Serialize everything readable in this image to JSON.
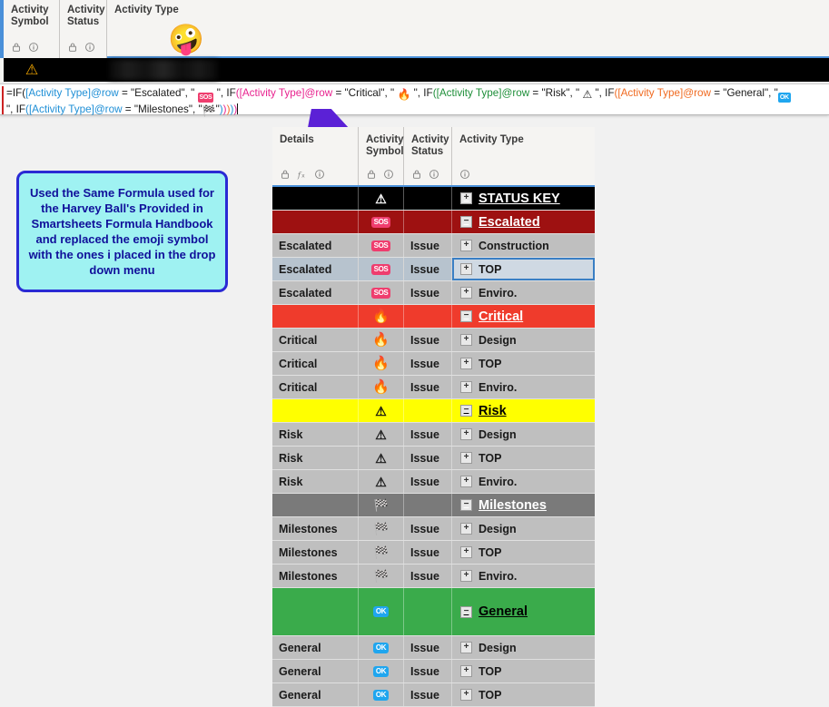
{
  "top_header": {
    "columns": [
      {
        "title": "Activity\nSymbol",
        "icons": [
          "lock-icon",
          "info-icon"
        ]
      },
      {
        "title": "Activity\nStatus",
        "icons": [
          "lock-icon",
          "info-icon"
        ]
      },
      {
        "title": "Activity Type",
        "icons": []
      }
    ],
    "col1_line1": "Activity",
    "col1_line2": "Symbol",
    "col2_line1": "Activity",
    "col2_line2": "Status",
    "col3_title": "Activity Type",
    "emoji": "zany-face-emoji",
    "emoji_glyph": "🤪",
    "active_row_symbol": "⚠",
    "redacted_value": ""
  },
  "formula_bar": {
    "full_formula": "=IF([Activity Type]@row = \"Escalated\", \" 🆘 \", IF([Activity Type]@row = \"Critical\", \" 🔥 \", IF([Activity Type]@row = \"Risk\", \" ⚠ \", IF([Activity Type]@row = \"General\", \" 🆗 \", IF([Activity Type]@row = \"Milestones\", \" 🏁 \")))))",
    "tokens": {
      "t1": "=IF(",
      "ref1": "[Activity Type]@row",
      "t2": " = \"Escalated\", \"",
      "sym1": "SOS",
      "t3": "\", IF(",
      "ref2": "[Activity Type]@row",
      "t4": " = \"Critical\", \"",
      "sym2": "🔥",
      "t5": "\", IF(",
      "ref3": "[Activity Type]@row",
      "t6": " = \"Risk\", \"",
      "sym3": "⚠",
      "t7": "\", IF(",
      "ref4": "[Activity Type]@row",
      "t8": " = \"General\", \"",
      "sym4": "OK",
      "t9": "\", IF(",
      "ref5": "[Activity Type]@row",
      "t10": " = \"Milestones\", \"",
      "sym5": "🏁",
      "t11": "\")",
      "p1": ")",
      "p2": ")",
      "p3": ")",
      "p4": ")"
    }
  },
  "callout": {
    "text": "Used the Same Formula used for the Harvey Ball's Provided in Smartsheets Formula Handbook and replaced the emoji symbol with the ones i placed in the drop down menu",
    "border_color": "#2a2ad4",
    "fill_color": "#9ff2f2",
    "text_color": "#10109a"
  },
  "annotation": {
    "arrow_color": "#5b21d6",
    "arrow_name": "purple-pointer-arrow"
  },
  "grid": {
    "headers": {
      "details": "Details",
      "symbol_l1": "Activity",
      "symbol_l2": "Symbol",
      "status_l1": "Activity",
      "status_l2": "Status",
      "type": "Activity Type"
    },
    "header_icons": {
      "details": [
        "lock-icon",
        "formula-icon",
        "info-icon"
      ],
      "symbol": [
        "lock-icon",
        "info-icon"
      ],
      "status": [
        "lock-icon",
        "info-icon"
      ],
      "type": [
        "info-icon"
      ]
    },
    "rows": [
      {
        "kind": "group",
        "style": "black",
        "toggle": "+",
        "details": "",
        "symbol": "warn",
        "status": "",
        "type": "STATUS KEY"
      },
      {
        "kind": "group",
        "style": "darkred",
        "toggle": "−",
        "details": "",
        "symbol": "sos",
        "status": "",
        "type": "Escalated"
      },
      {
        "kind": "data",
        "details": "Escalated",
        "symbol": "sos",
        "status": "Issue",
        "toggle": "+",
        "type": "Construction"
      },
      {
        "kind": "data",
        "details": "Escalated",
        "symbol": "sos",
        "status": "Issue",
        "toggle": "+",
        "type": "TOP",
        "selected": true
      },
      {
        "kind": "data",
        "details": "Escalated",
        "symbol": "sos",
        "status": "Issue",
        "toggle": "+",
        "type": "Enviro."
      },
      {
        "kind": "group",
        "style": "red",
        "toggle": "−",
        "details": "",
        "symbol": "fire",
        "status": "",
        "type": "Critical"
      },
      {
        "kind": "data",
        "details": "Critical",
        "symbol": "fire",
        "status": "Issue",
        "toggle": "+",
        "type": "Design"
      },
      {
        "kind": "data",
        "details": "Critical",
        "symbol": "fire",
        "status": "Issue",
        "toggle": "+",
        "type": "TOP"
      },
      {
        "kind": "data",
        "details": "Critical",
        "symbol": "fire",
        "status": "Issue",
        "toggle": "+",
        "type": "Enviro."
      },
      {
        "kind": "group",
        "style": "yellow",
        "toggle": "−",
        "details": "",
        "symbol": "warn",
        "status": "",
        "type": "Risk"
      },
      {
        "kind": "data",
        "details": "Risk",
        "symbol": "warn",
        "status": "Issue",
        "toggle": "+",
        "type": "Design"
      },
      {
        "kind": "data",
        "details": "Risk",
        "symbol": "warn",
        "status": "Issue",
        "toggle": "+",
        "type": "TOP"
      },
      {
        "kind": "data",
        "details": "Risk",
        "symbol": "warn",
        "status": "Issue",
        "toggle": "+",
        "type": "Enviro."
      },
      {
        "kind": "group",
        "style": "gray",
        "toggle": "−",
        "details": "",
        "symbol": "flag",
        "status": "",
        "type": "Milestones"
      },
      {
        "kind": "data",
        "details": "Milestones",
        "symbol": "flag",
        "status": "Issue",
        "toggle": "+",
        "type": "Design"
      },
      {
        "kind": "data",
        "details": "Milestones",
        "symbol": "flag",
        "status": "Issue",
        "toggle": "+",
        "type": "TOP"
      },
      {
        "kind": "data",
        "details": "Milestones",
        "symbol": "flag",
        "status": "Issue",
        "toggle": "+",
        "type": "Enviro."
      },
      {
        "kind": "group",
        "style": "green",
        "toggle": "−",
        "details": "",
        "symbol": "ok",
        "status": "",
        "type": "General",
        "tall": true
      },
      {
        "kind": "data",
        "details": "General",
        "symbol": "ok",
        "status": "Issue",
        "toggle": "+",
        "type": "Design"
      },
      {
        "kind": "data",
        "details": "General",
        "symbol": "ok",
        "status": "Issue",
        "toggle": "+",
        "type": "TOP"
      },
      {
        "kind": "data",
        "details": "General",
        "symbol": "ok",
        "status": "Issue",
        "toggle": "+",
        "type": "TOP"
      }
    ],
    "symbol_glyphs": {
      "sos": "SOS",
      "fire": "🔥",
      "warn": "⚠",
      "flag": "🏁",
      "ok": "OK"
    },
    "colors": {
      "black": "#000000",
      "darkred": "#9e1111",
      "red": "#ef3b2c",
      "yellow": "#ffff00",
      "gray": "#7a7a7a",
      "green": "#3aab4b",
      "data_row": "#bfbfbf",
      "selected_row": "#b7c3ce"
    }
  }
}
